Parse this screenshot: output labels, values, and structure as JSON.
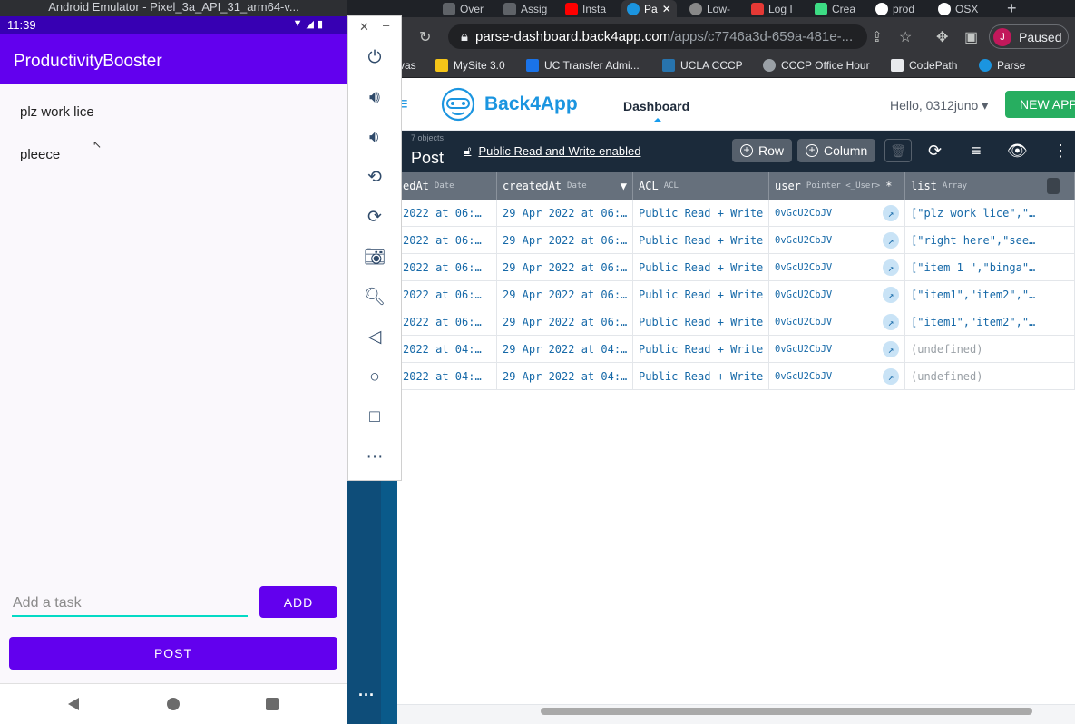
{
  "emulator": {
    "window_title": "Android Emulator - Pixel_3a_API_31_arm64-v...",
    "status_time": "11:39",
    "app_title": "ProductivityBooster",
    "tasks": [
      "plz work lice",
      "pleece"
    ],
    "input_placeholder": "Add a task",
    "add_label": "ADD",
    "post_label": "POST"
  },
  "browser": {
    "tabs": [
      {
        "label": "Over",
        "active": false
      },
      {
        "label": "Assig",
        "active": false
      },
      {
        "label": "Insta",
        "active": false
      },
      {
        "label": "Pa",
        "active": true
      },
      {
        "label": "Low-",
        "active": false
      },
      {
        "label": "Log I",
        "active": false
      },
      {
        "label": "Crea",
        "active": false
      },
      {
        "label": "prod",
        "active": false
      },
      {
        "label": "OSX",
        "active": false
      }
    ],
    "url_host": "parse-dashboard.back4app.com",
    "url_path": "/apps/c7746a3d-659a-481e-...",
    "profile_initial": "J",
    "profile_status": "Paused",
    "bookmarks": [
      "vas",
      "MySite 3.0",
      "UC Transfer Admi...",
      "UCLA CCCP",
      "CCCP Office Hour",
      "CodePath",
      "Parse"
    ]
  },
  "dashboard": {
    "logo_text": "Back4App",
    "nav_dashboard": "Dashboard",
    "hello": "Hello, 0312juno",
    "new_app": "NEW APP",
    "object_count": "7 objects",
    "class_name": "Post",
    "acl_text": "Public Read and Write enabled",
    "row_btn": "Row",
    "column_btn": "Column",
    "columns": [
      {
        "name": "edAt",
        "type": "Date"
      },
      {
        "name": "createdAt",
        "type": "Date"
      },
      {
        "name": "ACL",
        "type": "ACL"
      },
      {
        "name": "user",
        "type": "Pointer <_User>"
      },
      {
        "name": "list",
        "type": "Array"
      }
    ],
    "rows": [
      [
        "2022 at 06:…",
        "29 Apr 2022 at 06:…",
        "Public Read + Write",
        "0vGcU2CbJV",
        "[\"plz work lice\",\"…"
      ],
      [
        "2022 at 06:…",
        "29 Apr 2022 at 06:…",
        "Public Read + Write",
        "0vGcU2CbJV",
        "[\"right here\",\"see…"
      ],
      [
        "2022 at 06:…",
        "29 Apr 2022 at 06:…",
        "Public Read + Write",
        "0vGcU2CbJV",
        "[\"item 1 \",\"binga\"…"
      ],
      [
        "2022 at 06:…",
        "29 Apr 2022 at 06:…",
        "Public Read + Write",
        "0vGcU2CbJV",
        "[\"item1\",\"item2\",\"…"
      ],
      [
        "2022 at 06:…",
        "29 Apr 2022 at 06:…",
        "Public Read + Write",
        "0vGcU2CbJV",
        "[\"item1\",\"item2\",\"…"
      ],
      [
        "2022 at 04:…",
        "29 Apr 2022 at 04:…",
        "Public Read + Write",
        "0vGcU2CbJV",
        "(undefined)"
      ],
      [
        "2022 at 04:…",
        "29 Apr 2022 at 04:…",
        "Public Read + Write",
        "0vGcU2CbJV",
        "(undefined)"
      ]
    ]
  },
  "colors": {
    "android_primary": "#6200ee",
    "android_status": "#3700b3",
    "android_accent": "#03dac5",
    "b4a_blue": "#1b95e0",
    "b4a_toolbar": "#1b2a3a",
    "new_app_green": "#27ae60"
  },
  "icons": {
    "side_toolbar": [
      "power-icon",
      "volume-up-icon",
      "volume-down-icon",
      "rotate-left-icon",
      "rotate-right-icon",
      "camera-icon",
      "zoom-icon",
      "back-icon",
      "home-icon",
      "overview-icon",
      "more-icon"
    ]
  }
}
